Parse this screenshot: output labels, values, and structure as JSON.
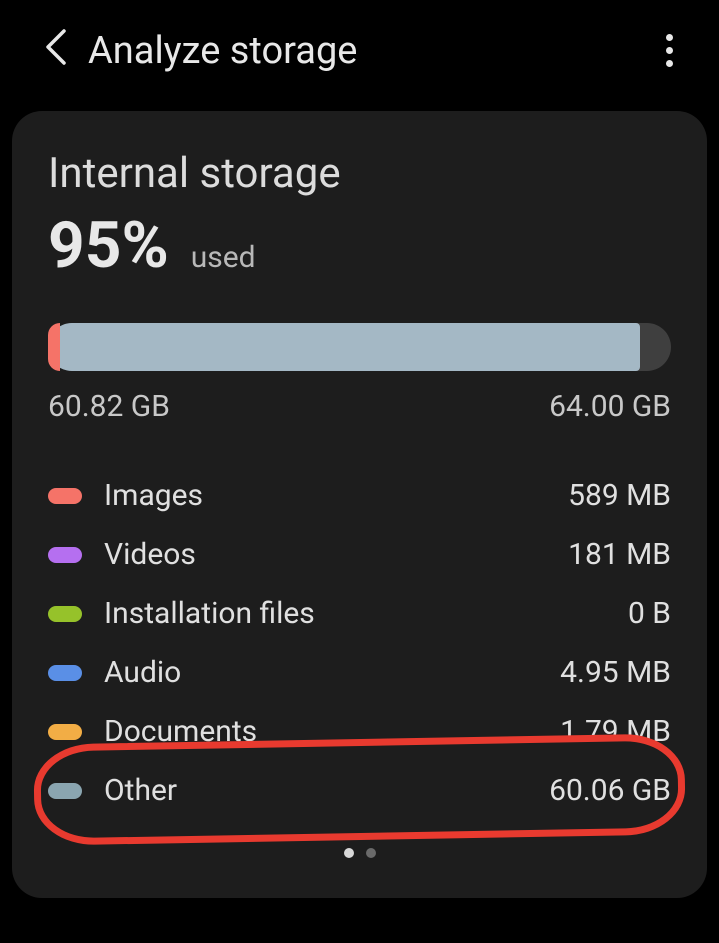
{
  "header": {
    "title": "Analyze storage"
  },
  "card": {
    "section_title": "Internal storage",
    "percent": "95%",
    "used_label": "used",
    "bar_fill_pct": 95,
    "used_size": "60.82 GB",
    "total_size": "64.00 GB"
  },
  "categories": [
    {
      "name": "Images",
      "size": "589 MB",
      "color": "#f57368"
    },
    {
      "name": "Videos",
      "size": "181 MB",
      "color": "#b56ff0"
    },
    {
      "name": "Installation files",
      "size": "0 B",
      "color": "#96c22a"
    },
    {
      "name": "Audio",
      "size": "4.95 MB",
      "color": "#5a8fe6"
    },
    {
      "name": "Documents",
      "size": "1.79 MB",
      "color": "#f2ad45"
    },
    {
      "name": "Other",
      "size": "60.06 GB",
      "color": "#8aa5b0"
    }
  ],
  "annotation": {
    "target_row": "Other"
  }
}
